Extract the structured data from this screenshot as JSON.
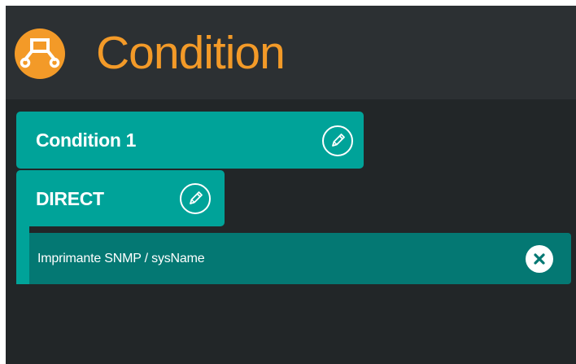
{
  "header": {
    "title": "Condition",
    "icon": "flow-branch-icon",
    "accent_color": "#f39a28"
  },
  "condition": {
    "label": "Condition 1",
    "edit_icon": "pencil-icon"
  },
  "operator": {
    "label": "DIRECT",
    "edit_icon": "pencil-icon"
  },
  "criteria": [
    {
      "label": "Imprimante SNMP / sysName",
      "remove_icon": "close-icon"
    }
  ],
  "colors": {
    "block": "#00a399",
    "criteria_row": "#047873",
    "background": "#222628",
    "header_background": "#2c3033"
  }
}
